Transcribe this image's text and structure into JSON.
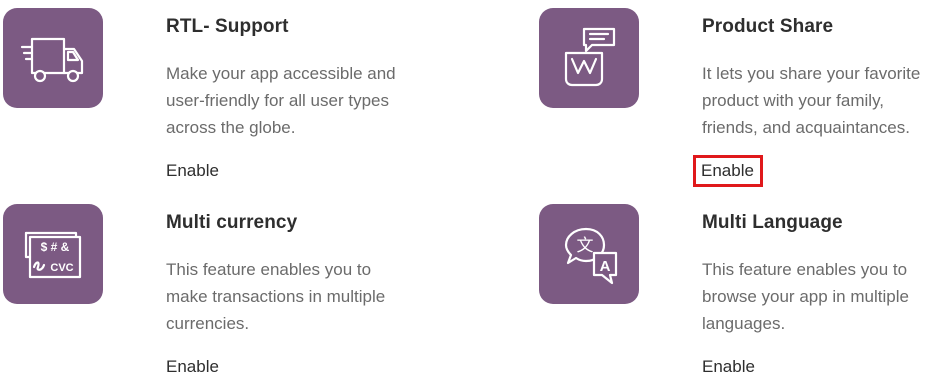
{
  "colors": {
    "tile_background": "#7c5a83",
    "icon_stroke": "#ffffff",
    "title_text": "#2e2e2e",
    "description_text": "#6b6b6b",
    "highlight_outline": "#e0181b"
  },
  "features": [
    {
      "title": "RTL- Support",
      "description": "Make your app accessible and user-friendly for all user types across the globe.",
      "action": "Enable",
      "icon": "delivery-truck-icon",
      "highlighted": false
    },
    {
      "title": "Product Share",
      "description": "It lets you share your favorite product with your family, friends, and acquaintances.",
      "action": "Enable",
      "icon": "share-basket-icon",
      "highlighted": true
    },
    {
      "title": "Multi currency",
      "description": "This feature enables you to make transactions in multiple currencies.",
      "action": "Enable",
      "icon": "currency-card-icon",
      "icon_text": {
        "symbols": "$ # &",
        "code": "CVC"
      },
      "highlighted": false
    },
    {
      "title": "Multi Language",
      "description": "This feature enables you to browse your app in multiple languages.",
      "action": "Enable",
      "icon": "translate-icon",
      "icon_text": {
        "glyph_a": "文",
        "glyph_b": "A"
      },
      "highlighted": false
    }
  ]
}
